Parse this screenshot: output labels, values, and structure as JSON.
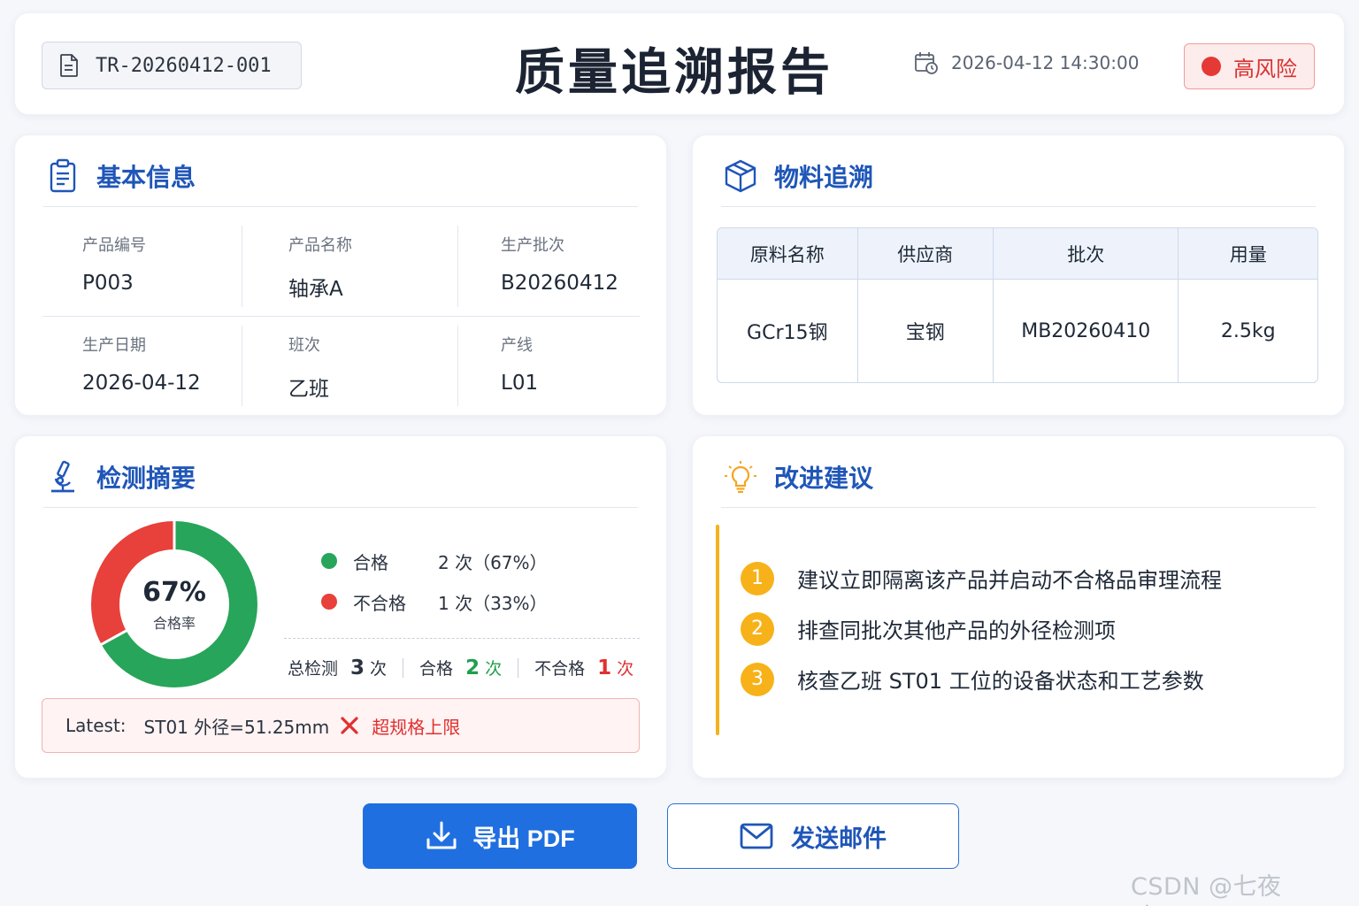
{
  "header": {
    "report_id": "TR-20260412-001",
    "title": "质量追溯报告",
    "datetime": "2026-04-12 14:30:00",
    "risk_label": "高风险",
    "risk_color": "#e53935"
  },
  "basic_info": {
    "title": "基本信息",
    "fields": [
      {
        "label": "产品编号",
        "value": "P003"
      },
      {
        "label": "产品名称",
        "value": "轴承A"
      },
      {
        "label": "生产批次",
        "value": "B20260412"
      },
      {
        "label": "生产日期",
        "value": "2026-04-12"
      },
      {
        "label": "班次",
        "value": "乙班"
      },
      {
        "label": "产线",
        "value": "L01"
      }
    ]
  },
  "material": {
    "title": "物料追溯",
    "columns": [
      "原料名称",
      "供应商",
      "批次",
      "用量"
    ],
    "rows": [
      [
        "GCr15钢",
        "宝钢",
        "MB20260410",
        "2.5kg"
      ]
    ]
  },
  "summary": {
    "title": "检测摘要",
    "donut": {
      "pass_fraction": 0.67,
      "pct_label": "67%",
      "sub_label": "合格率",
      "pass_color": "#27a55a",
      "fail_color": "#e8403a"
    },
    "legend": [
      {
        "name": "合格",
        "value": "2 次（67%）",
        "color": "#27a55a"
      },
      {
        "name": "不合格",
        "value": "1 次（33%）",
        "color": "#e8403a"
      }
    ],
    "stats": {
      "total_label": "总检测",
      "total_num": "3",
      "total_unit": "次",
      "pass_label": "合格",
      "pass_num": "2",
      "pass_unit": "次",
      "fail_label": "不合格",
      "fail_num": "1",
      "fail_unit": "次"
    },
    "latest": {
      "label": "Latest:",
      "detail": "ST01 外径=51.25mm",
      "warning": "超规格上限"
    }
  },
  "suggestions": {
    "title": "改进建议",
    "items": [
      {
        "num": "1",
        "text": "建议立即隔离该产品并启动不合格品审理流程"
      },
      {
        "num": "2",
        "text": "排查同批次其他产品的外径检测项"
      },
      {
        "num": "3",
        "text": "核查乙班 ST01 工位的设备状态和工艺参数"
      }
    ]
  },
  "actions": {
    "export_label": "导出 PDF",
    "email_label": "发送邮件"
  },
  "watermark": "CSDN @七夜zippoe",
  "accent_color": "#1f6fe0"
}
